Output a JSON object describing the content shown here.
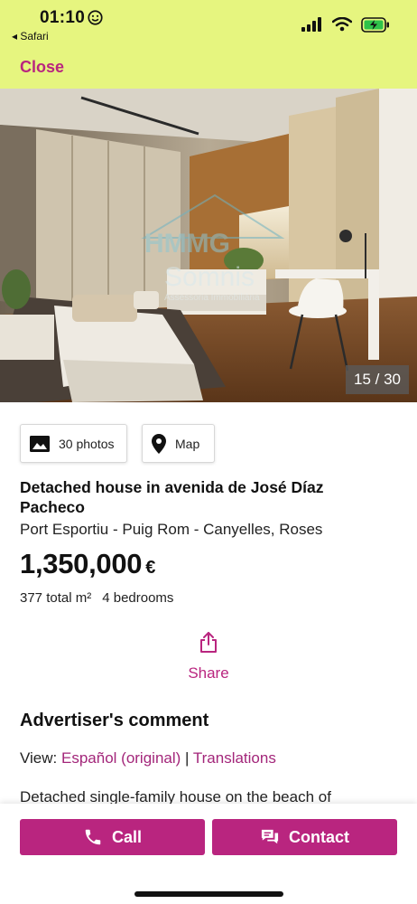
{
  "status_bar": {
    "time": "01:10",
    "back_app": "Safari"
  },
  "header": {
    "close_label": "Close"
  },
  "gallery": {
    "counter": "15 / 30",
    "watermark_line1": "HMMG",
    "watermark_line2": "Somnis",
    "watermark_line3": "Assessoria Immobiliària"
  },
  "chips": {
    "photos_label": "30 photos",
    "map_label": "Map"
  },
  "listing": {
    "title": "Detached house in avenida de José Díaz Pacheco",
    "location": "Port Esportiu - Puig Rom - Canyelles, Roses",
    "price": "1,350,000",
    "currency": "€",
    "area": "377 total m²",
    "bedrooms": "4 bedrooms"
  },
  "share": {
    "label": "Share"
  },
  "advertiser": {
    "heading": "Advertiser's comment",
    "view_prefix": "View:",
    "original_link": "Español (original)",
    "separator": "|",
    "translations_link": "Translations",
    "description_start": "Detached single-family house on the beach of"
  },
  "actions": {
    "call_label": "Call",
    "contact_label": "Contact"
  },
  "colors": {
    "accent": "#b9257f",
    "topbar": "#e6f57f"
  }
}
